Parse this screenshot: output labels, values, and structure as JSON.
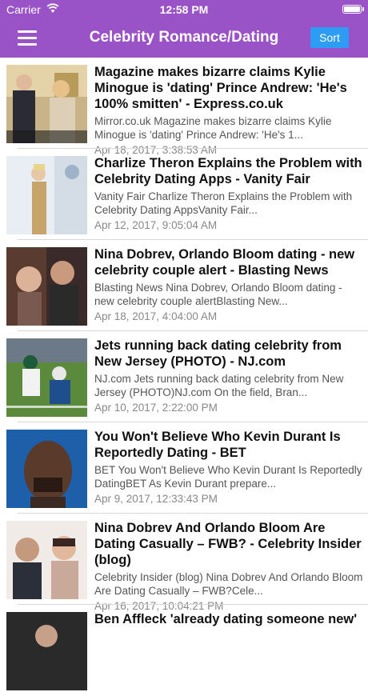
{
  "status_bar": {
    "carrier": "Carrier",
    "time": "12:58 PM"
  },
  "nav": {
    "title": "Celebrity Romance/Dating",
    "sort_label": "Sort"
  },
  "articles": [
    {
      "title": "Magazine makes bizarre claims Kylie Minogue is 'dating' Prince Andrew: 'He's 100% smitten' - Express.co.uk",
      "summary": "Mirror.co.uk    Magazine makes bizarre claims Kylie Minogue is 'dating' Prince Andrew: 'He's 1...",
      "date": "Apr 18, 2017, 3:38:53 AM"
    },
    {
      "title": "Charlize Theron Explains the Problem with Celebrity Dating Apps - Vanity Fair",
      "summary": "Vanity Fair    Charlize Theron Explains the Problem with Celebrity Dating AppsVanity Fair...",
      "date": "Apr 12, 2017, 9:05:04 AM"
    },
    {
      "title": "Nina Dobrev, Orlando Bloom dating - new celebrity couple alert - Blasting News",
      "summary": "Blasting News    Nina Dobrev, Orlando Bloom dating - new celebrity couple alertBlasting New...",
      "date": "Apr 18, 2017, 4:04:00 AM"
    },
    {
      "title": "Jets running back dating celebrity from New Jersey (PHOTO) - NJ.com",
      "summary": "NJ.com    Jets running back dating celebrity from New Jersey (PHOTO)NJ.com  On the field, Bran...",
      "date": "Apr 10, 2017, 2:22:00 PM"
    },
    {
      "title": "You Won't Believe Who Kevin Durant Is Reportedly Dating - BET",
      "summary": "BET    You Won't Believe Who Kevin Durant Is Reportedly DatingBET  As Kevin Durant prepare...",
      "date": "Apr 9, 2017, 12:33:43 PM"
    },
    {
      "title": "Nina Dobrev And Orlando Bloom Are Dating Casually – FWB? - Celebrity Insider (blog)",
      "summary": "Celebrity Insider (blog)    Nina Dobrev And Orlando Bloom Are Dating Casually – FWB?Cele...",
      "date": "Apr 16, 2017, 10:04:21 PM"
    },
    {
      "title": "Ben Affleck 'already dating someone new'",
      "summary": "",
      "date": ""
    }
  ]
}
